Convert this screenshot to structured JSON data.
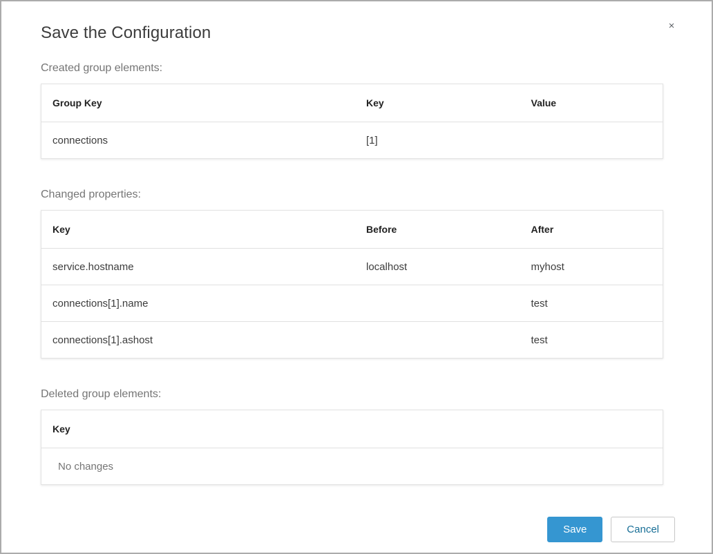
{
  "dialog": {
    "title": "Save the Configuration",
    "close_glyph": "×"
  },
  "sections": [
    {
      "label": "Created group elements:",
      "table": {
        "headers": [
          "Group Key",
          "Key",
          "Value"
        ],
        "rows": [
          [
            "connections",
            "[1]",
            ""
          ]
        ]
      }
    },
    {
      "label": "Changed properties:",
      "table": {
        "headers": [
          "Key",
          "Before",
          "After"
        ],
        "rows": [
          [
            "service.hostname",
            "localhost",
            "myhost"
          ],
          [
            "connections[1].name",
            "",
            "test"
          ],
          [
            "connections[1].ashost",
            "",
            "test"
          ]
        ]
      }
    },
    {
      "label": "Deleted group elements:",
      "table": {
        "headers": [
          "Key"
        ],
        "rows": [],
        "empty_text": "No changes"
      }
    }
  ],
  "buttons": {
    "save": "Save",
    "cancel": "Cancel"
  },
  "colors": {
    "accent": "#3596d1",
    "cancel_text": "#176e96",
    "section_label": "#757575",
    "table_border": "#e3e3e3",
    "dialog_border": "#ababab",
    "title_text": "#3c3c3c"
  }
}
